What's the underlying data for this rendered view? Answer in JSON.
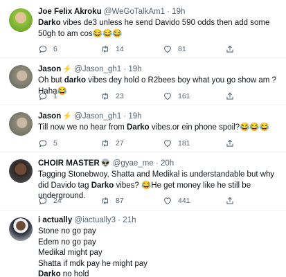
{
  "colors": {
    "text": "#0f1419",
    "muted": "#536471",
    "divider": "#eff3f4",
    "lightning": "#f5b800"
  },
  "icons": {
    "reply": "speech-bubble-icon",
    "retweet": "retweet-icon",
    "like": "heart-icon",
    "share": "share-icon",
    "badge": "lightning-icon"
  },
  "tweets": [
    {
      "name": "Joe Felix Akroku",
      "handle": "@WeGoTalkAm1",
      "sep": "·",
      "time": "19h",
      "text_parts": [
        {
          "bold": "Darko"
        },
        {
          "plain": " vibes de3 unless he send Davido 590 odds then add some 50gh to am cos😂😂😂"
        }
      ],
      "replies": "6",
      "retweets": "14",
      "likes": "81"
    },
    {
      "name": "Jason",
      "name_badge": "⚡",
      "handle": "@Jason_gh1",
      "sep": "·",
      "time": "19h",
      "text_parts": [
        {
          "plain": "Oh but "
        },
        {
          "bold": "darko"
        },
        {
          "plain": " vibes dey hold o R2bees boy what you go show am ? Haha😂"
        }
      ],
      "replies": "1",
      "retweets": "23",
      "likes": "161"
    },
    {
      "name": "Jason",
      "name_badge": "⚡",
      "handle": "@Jason_gh1",
      "sep": "·",
      "time": "19h",
      "text_parts": [
        {
          "plain": "Till now we no hear from "
        },
        {
          "bold": "Darko"
        },
        {
          "plain": " vibes.or ein phone spoil?😂😂😂"
        }
      ],
      "replies": "5",
      "retweets": "27",
      "likes": "181"
    },
    {
      "name": "CHOIR MASTER",
      "name_badge": "👽",
      "handle": "@gyae_me",
      "sep": "·",
      "time": "20h",
      "text_parts": [
        {
          "plain": "Tagging Stonebwoy, Shatta and Medikal is understandable but why did Davido tag "
        },
        {
          "bold": "Darko"
        },
        {
          "plain": " vibes? 😂He get money like he still be underground."
        }
      ],
      "replies": "24",
      "retweets": "87",
      "likes": "441"
    },
    {
      "name": "i actually",
      "handle": "@iactually3",
      "sep": "·",
      "time": "21h",
      "text_parts": [
        {
          "plain": "Stone no go pay\nEdem no go pay\nMedikal might pay\nShatta if mdk pay he might pay\n"
        },
        {
          "bold": "Darko"
        },
        {
          "plain": " no hold"
        }
      ]
    }
  ]
}
